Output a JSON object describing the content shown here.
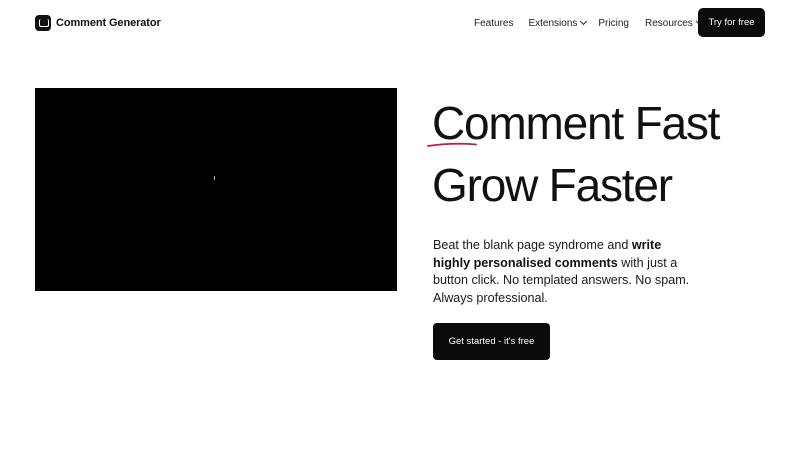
{
  "header": {
    "logo_text": "Comment Generator",
    "nav": [
      {
        "label": "Features"
      },
      {
        "label": "Extensions"
      },
      {
        "label": "Pricing"
      },
      {
        "label": "Resources"
      }
    ],
    "cta_label": "Try for free"
  },
  "hero": {
    "headline_line1": "Comment Fast",
    "headline_line2": "Grow Faster",
    "desc_part1": "Beat the blank page syndrome and ",
    "desc_bold": "write highly personalised comments",
    "desc_part2": " with just a button click. No templated answers. No spam. Always professional.",
    "cta_label": "Get started - it's free"
  },
  "colors": {
    "accent_underline": "#c2185b",
    "button_bg": "#0b0b0b",
    "video_bg": "#000000"
  }
}
